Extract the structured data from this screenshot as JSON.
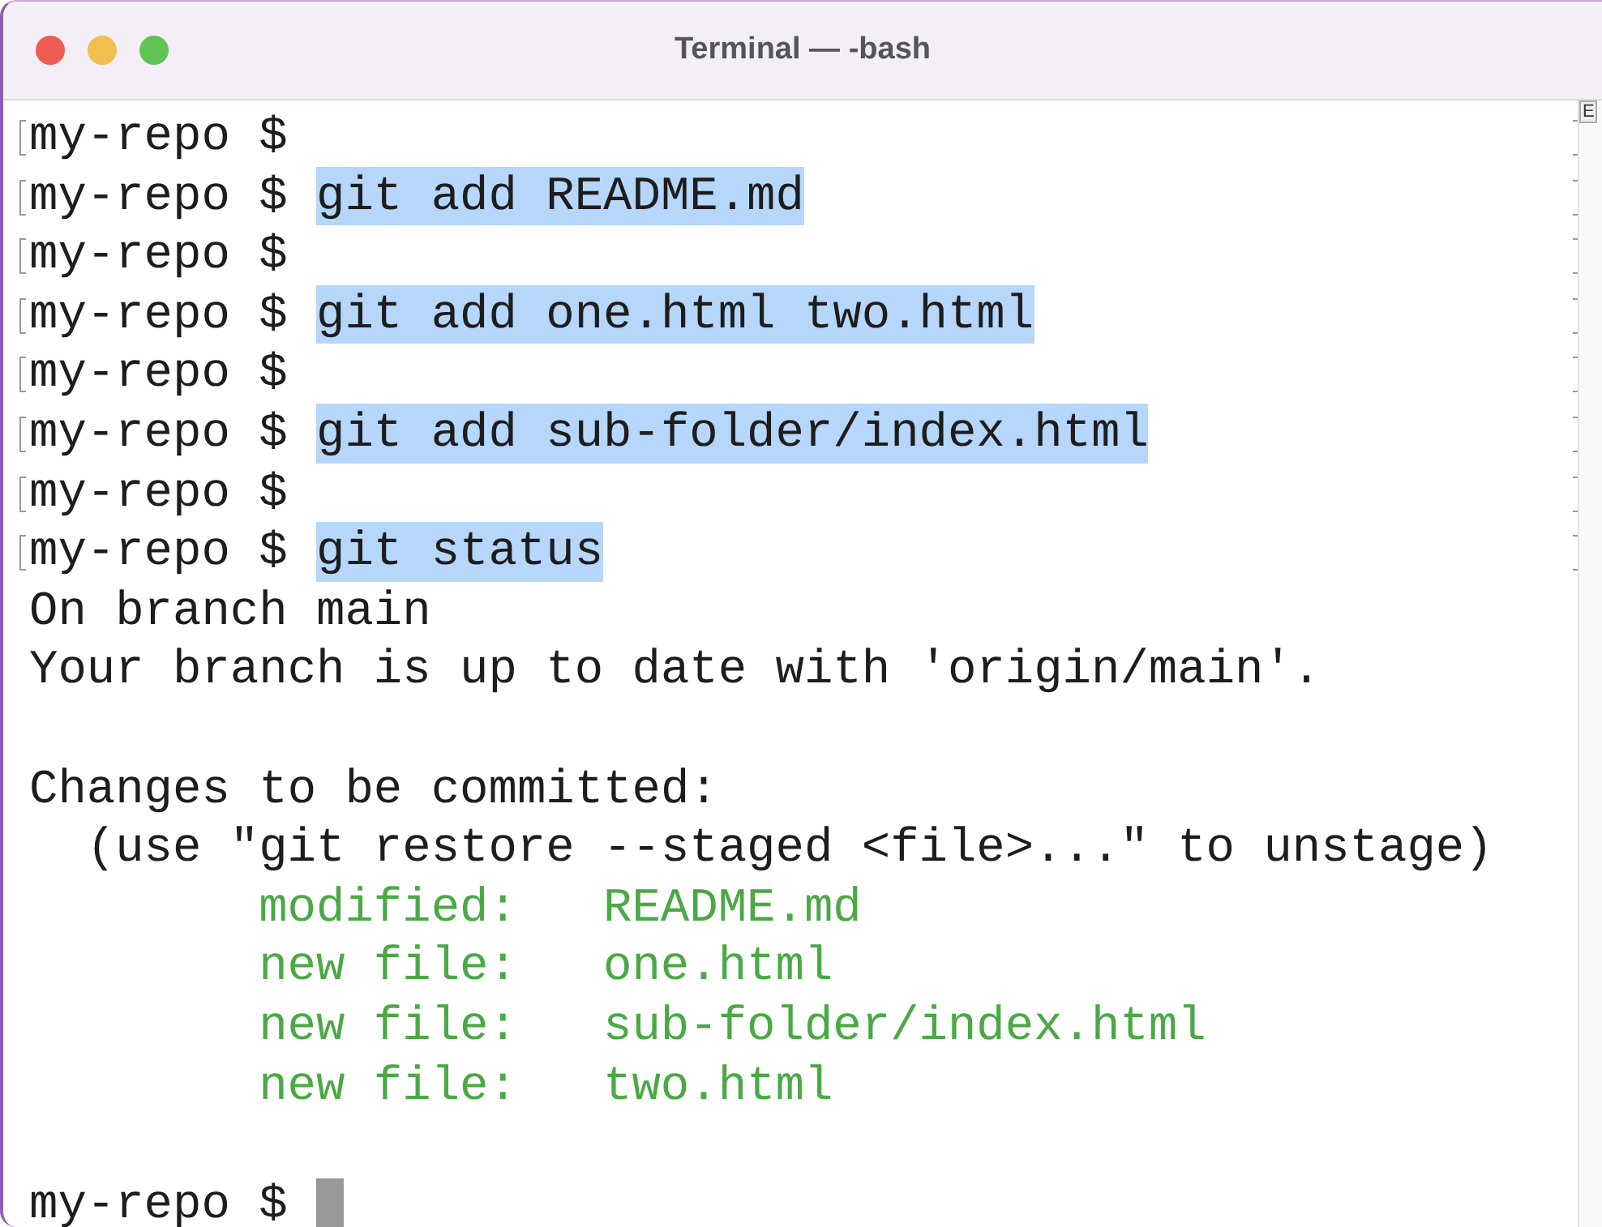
{
  "window": {
    "title": "Terminal — -bash"
  },
  "scrollbar_tab": "E",
  "lines": [
    {
      "kind": "prompt",
      "prompt": "my-repo $",
      "marked": true
    },
    {
      "kind": "prompt",
      "prompt": "my-repo $",
      "command": "git add README.md",
      "marked": true,
      "highlighted": true
    },
    {
      "kind": "prompt",
      "prompt": "my-repo $",
      "marked": true
    },
    {
      "kind": "prompt",
      "prompt": "my-repo $",
      "command": "git add one.html two.html",
      "marked": true,
      "highlighted": true
    },
    {
      "kind": "prompt",
      "prompt": "my-repo $",
      "marked": true
    },
    {
      "kind": "prompt",
      "prompt": "my-repo $",
      "command": "git add sub-folder/index.html",
      "marked": true,
      "highlighted": true
    },
    {
      "kind": "prompt",
      "prompt": "my-repo $",
      "marked": true
    },
    {
      "kind": "prompt",
      "prompt": "my-repo $",
      "command": "git status",
      "marked": true,
      "highlighted": true
    },
    {
      "kind": "output",
      "text": "On branch main"
    },
    {
      "kind": "output",
      "text": "Your branch is up to date with 'origin/main'."
    },
    {
      "kind": "blank"
    },
    {
      "kind": "output",
      "text": "Changes to be committed:"
    },
    {
      "kind": "hint",
      "text": "(use \"git restore --staged <file>...\" to unstage)"
    },
    {
      "kind": "staged",
      "label": "modified:",
      "file": "README.md"
    },
    {
      "kind": "staged",
      "label": "new file:",
      "file": "one.html"
    },
    {
      "kind": "staged",
      "label": "new file:",
      "file": "sub-folder/index.html"
    },
    {
      "kind": "staged",
      "label": "new file:",
      "file": "two.html"
    },
    {
      "kind": "blank"
    },
    {
      "kind": "prompt",
      "prompt": "my-repo $",
      "cursor": true
    }
  ]
}
